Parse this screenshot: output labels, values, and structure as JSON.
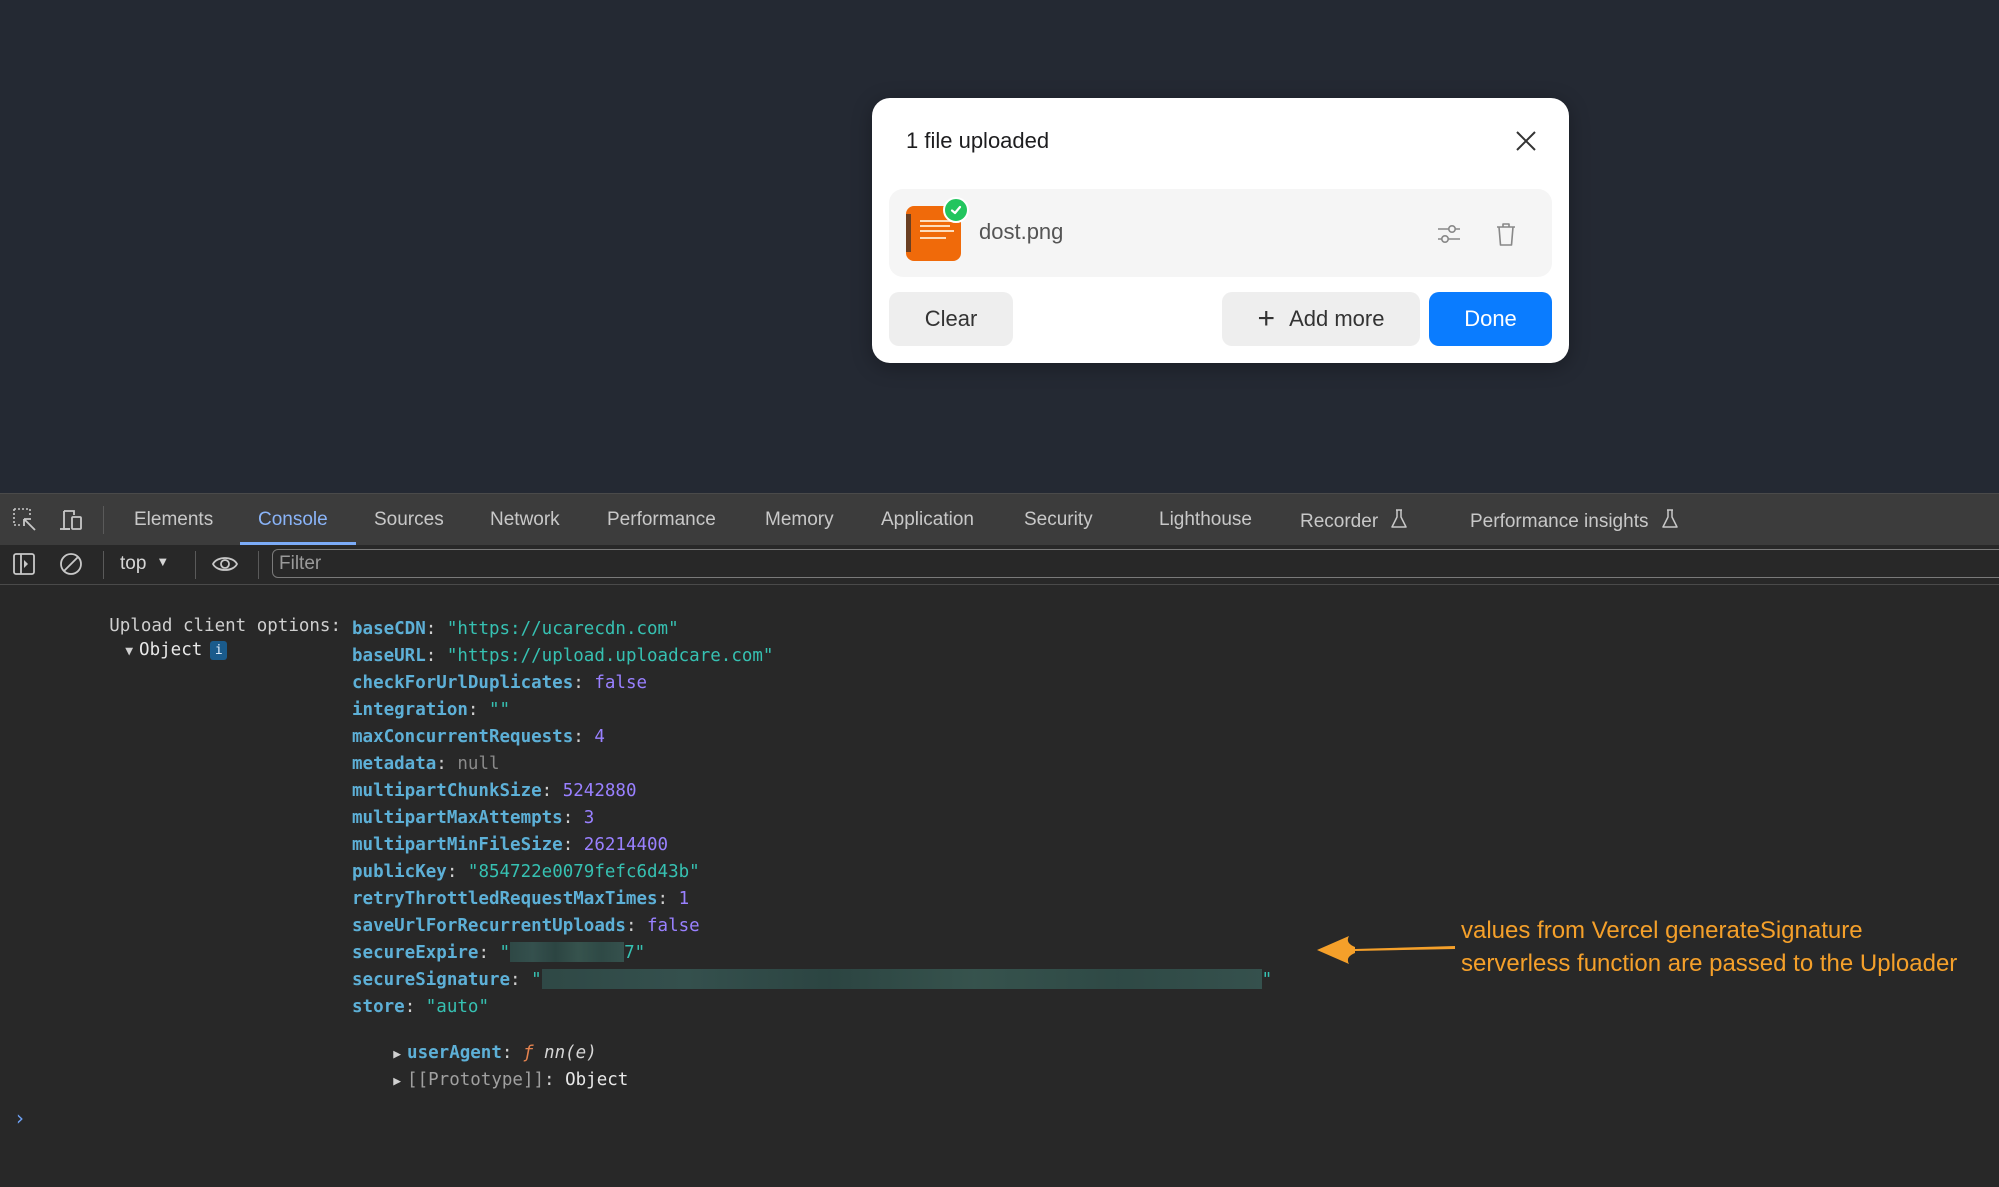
{
  "dialog": {
    "title": "1 file uploaded",
    "file": {
      "name": "dost.png",
      "status": "uploaded"
    },
    "buttons": {
      "clear": "Clear",
      "add_more": "Add more",
      "done": "Done"
    },
    "accent_color": "#0a7cff"
  },
  "devtools": {
    "tabs": [
      {
        "label": "Elements"
      },
      {
        "label": "Console",
        "active": true
      },
      {
        "label": "Sources"
      },
      {
        "label": "Network"
      },
      {
        "label": "Performance"
      },
      {
        "label": "Memory"
      },
      {
        "label": "Application"
      },
      {
        "label": "Security"
      },
      {
        "label": "Lighthouse"
      },
      {
        "label": "Recorder",
        "experimental": true
      },
      {
        "label": "Performance insights",
        "experimental": true
      }
    ],
    "toolbar": {
      "context": "top",
      "filter_placeholder": "Filter",
      "filter_value": ""
    },
    "console": {
      "log_label": "Upload client options:",
      "object_label": "Object",
      "info_badge": "i",
      "properties": [
        {
          "key": "baseCDN",
          "value": "\"https://ucarecdn.com\"",
          "type": "string"
        },
        {
          "key": "baseURL",
          "value": "\"https://upload.uploadcare.com\"",
          "type": "string"
        },
        {
          "key": "checkForUrlDuplicates",
          "value": "false",
          "type": "boolean"
        },
        {
          "key": "integration",
          "value": "\"\"",
          "type": "string"
        },
        {
          "key": "maxConcurrentRequests",
          "value": "4",
          "type": "number"
        },
        {
          "key": "metadata",
          "value": "null",
          "type": "null"
        },
        {
          "key": "multipartChunkSize",
          "value": "5242880",
          "type": "number"
        },
        {
          "key": "multipartMaxAttempts",
          "value": "3",
          "type": "number"
        },
        {
          "key": "multipartMinFileSize",
          "value": "26214400",
          "type": "number"
        },
        {
          "key": "publicKey",
          "value": "\"854722e0079fefc6d43b\"",
          "type": "string"
        },
        {
          "key": "retryThrottledRequestMaxTimes",
          "value": "1",
          "type": "number"
        },
        {
          "key": "saveUrlForRecurrentUploads",
          "value": "false",
          "type": "boolean"
        },
        {
          "key": "secureExpire",
          "value_prefix": "\"",
          "value_suffix": "7\"",
          "type": "redacted"
        },
        {
          "key": "secureSignature",
          "value_prefix": "\"",
          "value_suffix": "\"",
          "type": "redacted"
        },
        {
          "key": "store",
          "value": "\"auto\"",
          "type": "string"
        }
      ],
      "user_agent": {
        "key": "userAgent",
        "fn_symbol": "ƒ",
        "fn_signature": "nn(e)"
      },
      "prototype": {
        "key": "[[Prototype]]",
        "value": "Object"
      },
      "prompt_symbol": "›"
    }
  },
  "annotation": {
    "line1": "values from Vercel generateSignature",
    "line2": "serverless function are passed to the Uploader",
    "color": "#f5a02a"
  }
}
